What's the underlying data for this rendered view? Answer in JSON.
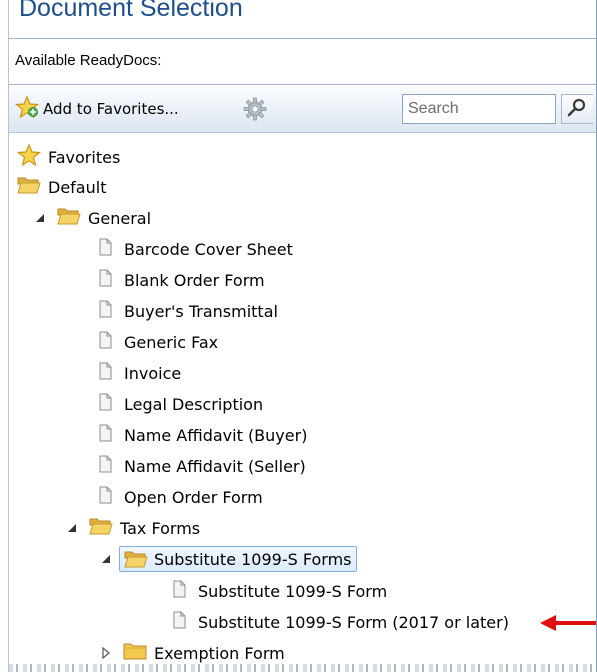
{
  "panel": {
    "title": "Document Selection",
    "subtitle": "Available ReadyDocs:"
  },
  "toolbar": {
    "add_favorites_label": "Add to Favorites...",
    "search_placeholder": "Search"
  },
  "tree": {
    "favorites": "Favorites",
    "default": "Default",
    "general": "General",
    "general_items": [
      "Barcode Cover Sheet",
      "Blank Order Form",
      "Buyer's Transmittal",
      "Generic Fax",
      "Invoice",
      "Legal Description",
      "Name Affidavit (Buyer)",
      "Name Affidavit (Seller)",
      "Open Order Form"
    ],
    "tax_forms": "Tax Forms",
    "substitute_folder": "Substitute 1099-S Forms",
    "substitute_items": [
      "Substitute 1099-S Form",
      "Substitute 1099-S Form (2017 or later)"
    ],
    "exemption": "Exemption Form"
  },
  "colors": {
    "title": "#1f4e8c",
    "annotation_arrow": "#e01010",
    "folder": "#f2c94c",
    "selection_border": "#84acdd"
  },
  "icons": {
    "favorites": "star-icon",
    "folder": "folder-icon",
    "document": "document-icon",
    "settings": "gear-icon",
    "search": "search-icon"
  }
}
